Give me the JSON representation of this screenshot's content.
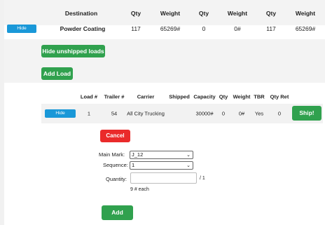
{
  "destination_table": {
    "headers": {
      "destination": "Destination",
      "qty1": "Qty",
      "weight1": "Weight",
      "qty2": "Qty",
      "weight2": "Weight",
      "qty3": "Qty",
      "weight3": "Weight"
    },
    "row": {
      "hide_label": "Hide",
      "destination": "Powder Coating",
      "qty1": "117",
      "weight1": "65269#",
      "qty2": "0",
      "weight2": "0#",
      "qty3": "117",
      "weight3": "65269#"
    }
  },
  "actions": {
    "hide_unshipped_label": "Hide unshipped loads",
    "add_load_label": "Add Load"
  },
  "loads_table": {
    "headers": {
      "load_num": "Load #",
      "trailer_num": "Trailer #",
      "carrier": "Carrier",
      "shipped": "Shipped",
      "capacity": "Capacity",
      "qty": "Qty",
      "weight": "Weight",
      "tbr": "TBR",
      "qty_ret": "Qty Ret"
    },
    "row": {
      "hide_label": "Hide",
      "load_num": "1",
      "trailer_num": "54",
      "carrier": "All City Trucking",
      "shipped": "",
      "capacity": "30000#",
      "qty": "0",
      "weight": "0#",
      "tbr": "Yes",
      "qty_ret": "0",
      "ship_label": "Ship!"
    }
  },
  "form": {
    "cancel_label": "Cancel",
    "main_mark_label": "Main Mark:",
    "main_mark_value": "J_12",
    "sequence_label": "Sequence:",
    "sequence_value": "1",
    "quantity_label": "Quantity:",
    "quantity_value": "",
    "quantity_suffix": "/ 1",
    "each_text": "9 # each",
    "add_label": "Add"
  },
  "colors": {
    "blue": "#1a98d8",
    "green": "#30a14e",
    "red": "#ea2a2a"
  }
}
